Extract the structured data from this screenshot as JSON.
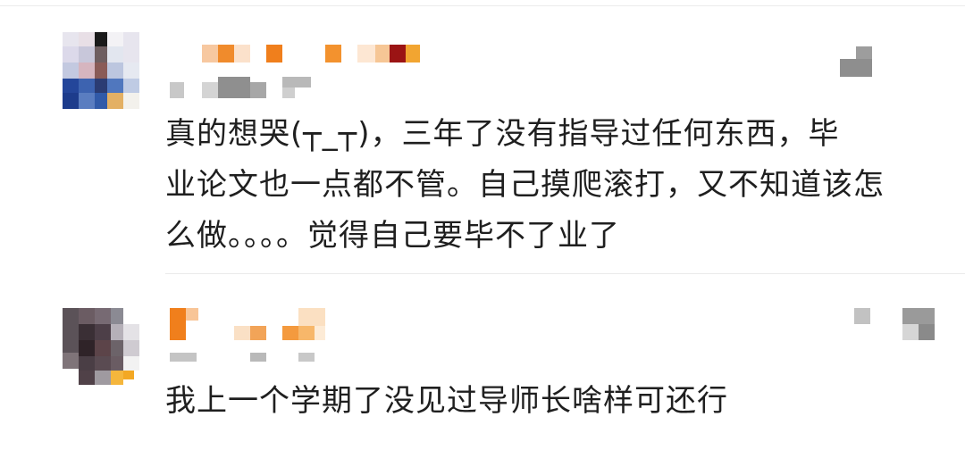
{
  "comments": [
    {
      "text_lines": [
        "真的想哭(┬_┬)，三年了没有指导过任何东西，毕",
        "业论文也一点都不管。自己摸爬滚打，又不知道该怎",
        "么做。。。。觉得自己要毕不了业了"
      ],
      "avatar": "pixelated-avatar",
      "username_censored": true
    },
    {
      "text_lines": [
        "我上一个学期了没见过导师长啥样可还行"
      ],
      "avatar": "pixelated-avatar",
      "username_censored": true
    }
  ],
  "colors": {
    "text": "#1f1f1f",
    "accent_orange": "#f07f1c",
    "divider": "#ebebeb"
  }
}
